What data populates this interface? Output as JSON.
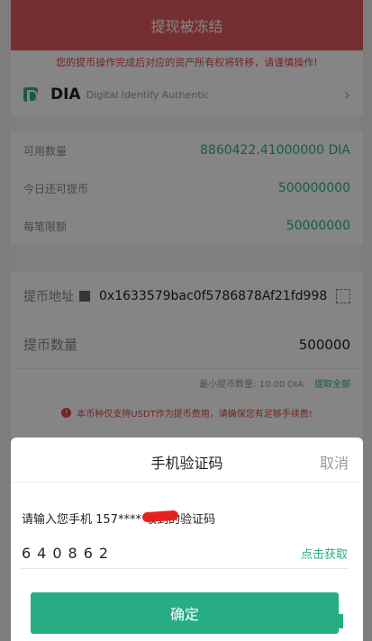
{
  "header": {
    "title": "提现被冻结"
  },
  "warning": "您的提币操作完成后对应的资产所有权将转移，请谨慎操作!",
  "coin": {
    "symbol": "DIA",
    "name": "Digital Identify Authentic"
  },
  "fields": [
    {
      "label": "可用数量",
      "value": "8860422.41000000 DIA"
    },
    {
      "label": "今日还可提币",
      "value": "500000000"
    },
    {
      "label": "每笔限额",
      "value": "50000000"
    }
  ],
  "address": {
    "label": "提币地址",
    "value": "0x1633579bac0f5786878Af21fd998"
  },
  "amount": {
    "label": "提币数量",
    "value": "500000"
  },
  "min": {
    "text": "最小提币数量: 10.00 DIA",
    "all_label": "提取全部"
  },
  "notice": {
    "icon": "!",
    "text": "本币种仅支持USDT作为提币费用，请确保您有足够手续费!"
  },
  "sheet": {
    "title": "手机验证码",
    "cancel_label": "取消",
    "prompt": "请输入您手机 157****     收到的验证码",
    "code_value": "640862",
    "get_code_label": "点击获取",
    "confirm_label": "确定"
  },
  "colors": {
    "header": "#e25a5f",
    "accent": "#2fae83",
    "warning": "#e0454b"
  }
}
